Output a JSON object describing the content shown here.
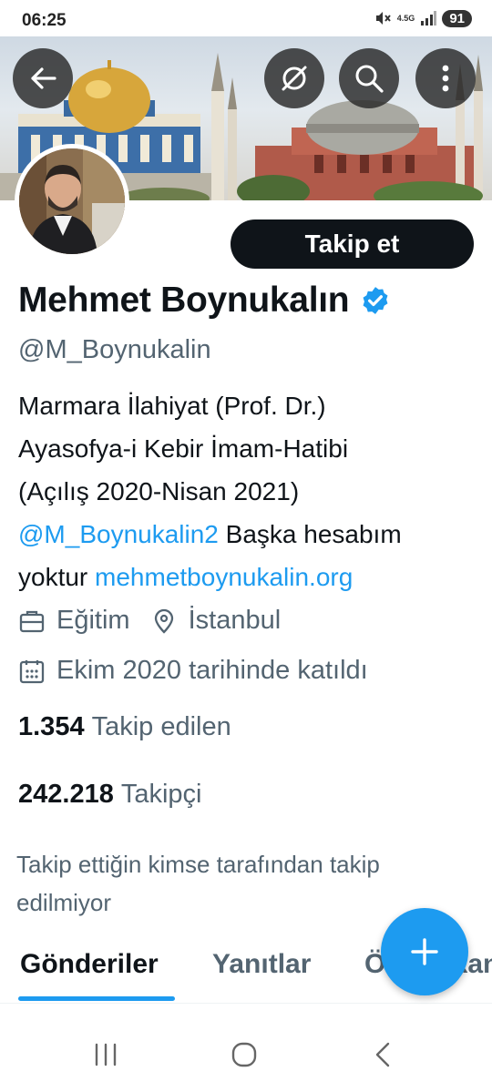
{
  "status_bar": {
    "time": "06:25",
    "network": "4.5G",
    "battery": "91",
    "icons": [
      "mute-icon",
      "network-icon",
      "signal-icon",
      "battery-icon"
    ]
  },
  "header": {
    "back_icon": "arrow-left-icon",
    "mute_icon": "bell-off-icon",
    "search_icon": "search-icon",
    "more_icon": "more-vertical-icon"
  },
  "profile": {
    "display_name": "Mehmet Boynukalın",
    "verified": true,
    "handle": "@M_Boynukalin",
    "follow_button": "Takip et",
    "bio": {
      "line1": "Marmara İlahiyat (Prof. Dr.)",
      "line2": "Ayasofya-i Kebir İmam-Hatibi",
      "line3": "(Açılış 2020-Nisan 2021)",
      "mention": "@M_Boynukalin2",
      "text_after_mention": " Başka hesabım",
      "text_before_link": "yoktur ",
      "website": "mehmetboynukalin.org"
    },
    "category": "Eğitim",
    "location": "İstanbul",
    "joined": "Ekim 2020 tarihinde katıldı",
    "following_count": "1.354",
    "following_label": "Takip edilen",
    "followers_count": "242.218",
    "followers_label": "Takipçi",
    "not_followed_note": "Takip ettiğin kimse tarafından takip edilmiyor"
  },
  "tabs": [
    {
      "label": "Gönderiler",
      "active": true
    },
    {
      "label": "Yanıtlar",
      "active": false
    },
    {
      "label": "Öne Çıkanlar",
      "active": false
    }
  ],
  "fab": {
    "icon": "plus-icon"
  },
  "nav_bar": {
    "icons": [
      "recent-apps-icon",
      "home-icon",
      "back-icon"
    ]
  },
  "colors": {
    "accent": "#1d9bf0",
    "text_primary": "#0f1419",
    "text_secondary": "#536471",
    "button_dark": "#0f1419"
  }
}
